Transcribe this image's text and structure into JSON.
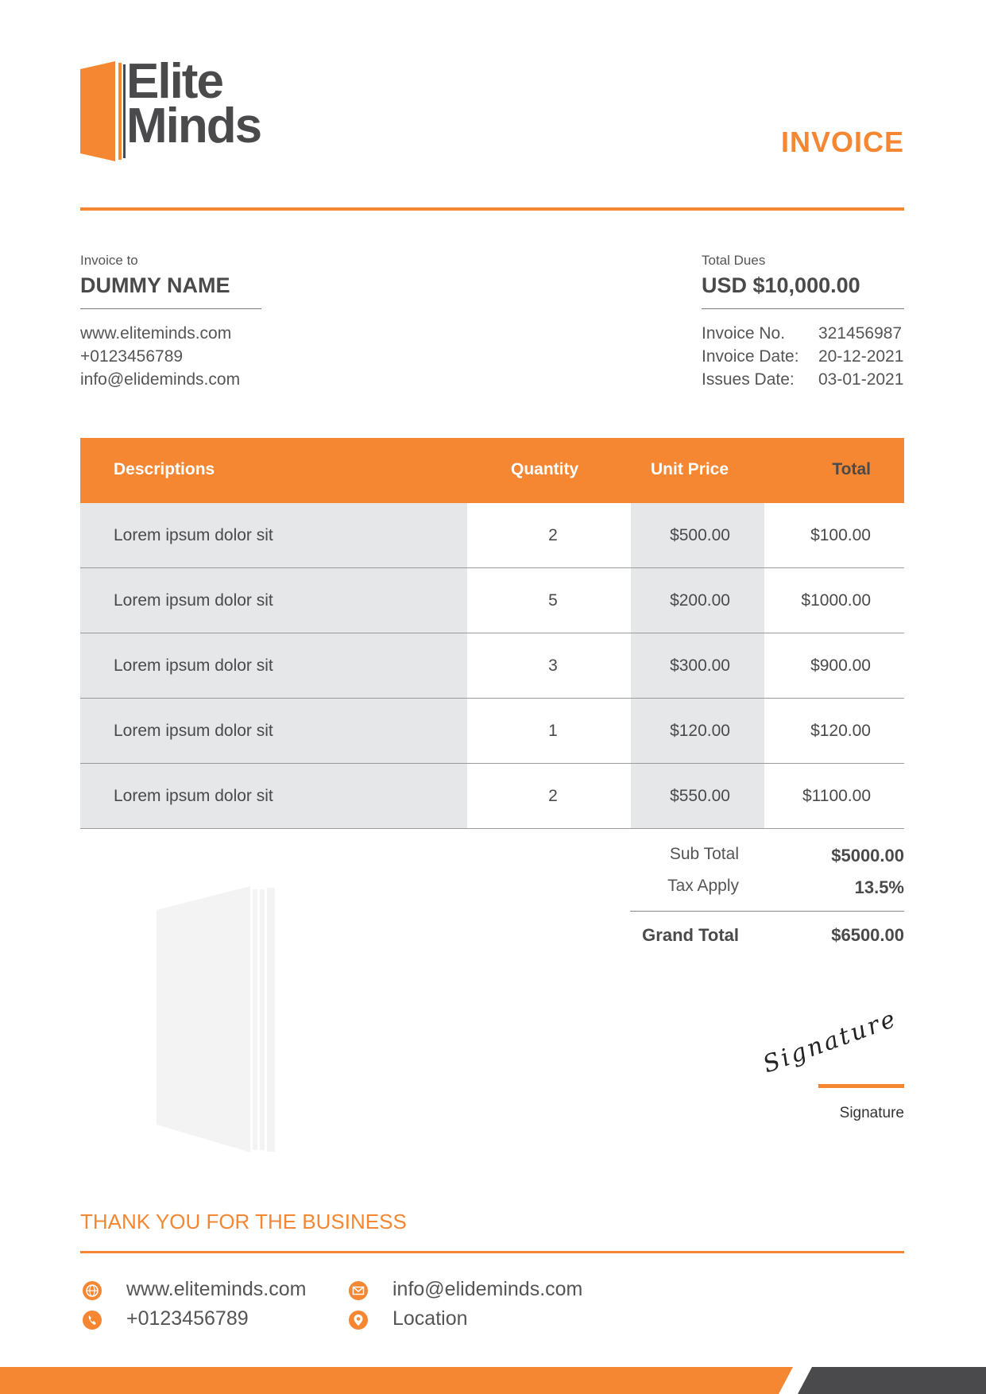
{
  "brand": {
    "logo_line1": "Elite",
    "logo_line2": "Minds",
    "accent_color": "#f58733",
    "text_color": "#4a4a4c"
  },
  "document": {
    "title": "INVOICE"
  },
  "bill_to": {
    "label": "Invoice to",
    "name": "DUMMY NAME",
    "website": "www.eliteminds.com",
    "phone": "+0123456789",
    "email": "info@elideminds.com"
  },
  "dues": {
    "label": "Total Dues",
    "amount": "USD $10,000.00",
    "invoice_no_label": "Invoice No.",
    "invoice_no": "321456987",
    "invoice_date_label": "Invoice Date:",
    "invoice_date": "20-12-2021",
    "issue_date_label": "Issues Date:",
    "issue_date": "03-01-2021"
  },
  "table": {
    "headers": {
      "description": "Descriptions",
      "quantity": "Quantity",
      "unit_price": "Unit Price",
      "total": "Total"
    },
    "rows": [
      {
        "description": "Lorem ipsum dolor sit",
        "quantity": "2",
        "unit_price": "$500.00",
        "total": "$100.00"
      },
      {
        "description": "Lorem ipsum dolor sit",
        "quantity": "5",
        "unit_price": "$200.00",
        "total": "$1000.00"
      },
      {
        "description": "Lorem ipsum dolor sit",
        "quantity": "3",
        "unit_price": "$300.00",
        "total": "$900.00"
      },
      {
        "description": "Lorem ipsum dolor sit",
        "quantity": "1",
        "unit_price": "$120.00",
        "total": "$120.00"
      },
      {
        "description": "Lorem ipsum dolor sit",
        "quantity": "2",
        "unit_price": "$550.00",
        "total": "$1100.00"
      }
    ]
  },
  "totals": {
    "subtotal_label": "Sub Total",
    "subtotal": "$5000.00",
    "tax_label": "Tax Apply",
    "tax": "13.5%",
    "grand_label": "Grand Total",
    "grand": "$6500.00"
  },
  "signature": {
    "script_text": "Signature",
    "label": "Signature"
  },
  "footer": {
    "thanks": "THANK YOU FOR THE BUSINESS",
    "website": "www.eliteminds.com",
    "phone": "+0123456789",
    "email": "info@elideminds.com",
    "location": "Location",
    "icons": [
      "globe-icon",
      "phone-icon",
      "mail-icon",
      "location-pin-icon"
    ],
    "bar_dark_color": "#4a4a4c"
  }
}
